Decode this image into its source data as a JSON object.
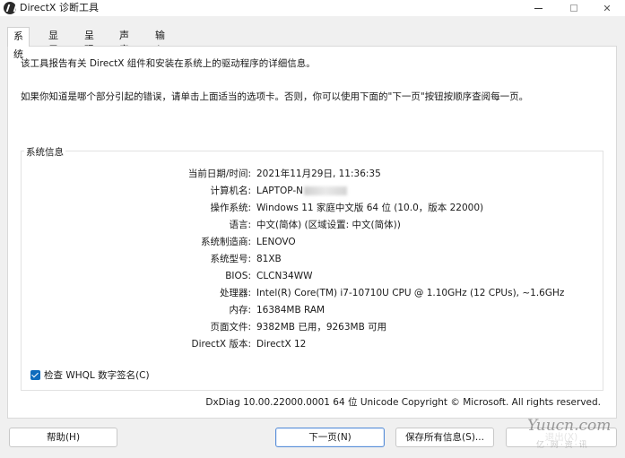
{
  "window": {
    "title": "DirectX 诊断工具",
    "icons": {
      "app": "directx-logo-icon",
      "minimize": "minimize-icon",
      "maximize": "maximize-icon",
      "close": "close-icon"
    },
    "close_glyph": "✕"
  },
  "tabs": [
    {
      "label": "系统",
      "active": true
    },
    {
      "label": "显示",
      "active": false
    },
    {
      "label": "呈现",
      "active": false
    },
    {
      "label": "声音",
      "active": false
    },
    {
      "label": "输入",
      "active": false
    }
  ],
  "intro": {
    "line1": "该工具报告有关 DirectX 组件和安装在系统上的驱动程序的详细信息。",
    "line2": "如果你知道是哪个部分引起的错误，请单击上面适当的选项卡。否则，你可以使用下面的\"下一页\"按钮按顺序查阅每一页。"
  },
  "system_info": {
    "group_label": "系统信息",
    "rows": [
      {
        "label": "当前日期/时间:",
        "value": "2021年11月29日, 11:36:35"
      },
      {
        "label": "计算机名:",
        "value": "LAPTOP-N"
      },
      {
        "label": "操作系统:",
        "value": "Windows 11 家庭中文版 64 位 (10.0，版本 22000)"
      },
      {
        "label": "语言:",
        "value": "中文(简体) (区域设置: 中文(简体))"
      },
      {
        "label": "系统制造商:",
        "value": "LENOVO"
      },
      {
        "label": "系统型号:",
        "value": "81XB"
      },
      {
        "label": "BIOS:",
        "value": "CLCN34WW"
      },
      {
        "label": "处理器:",
        "value": "Intel(R) Core(TM) i7-10710U CPU @ 1.10GHz (12 CPUs), ~1.6GHz"
      },
      {
        "label": "内存:",
        "value": "16384MB RAM"
      },
      {
        "label": "页面文件:",
        "value": "9382MB 已用，9263MB 可用"
      },
      {
        "label": "DirectX 版本:",
        "value": "DirectX 12"
      }
    ]
  },
  "whql": {
    "label": "检查 WHQL 数字签名(C)",
    "checked": true,
    "icon": "checkbox-checked-icon"
  },
  "copyright": "DxDiag 10.00.22000.0001 64 位 Unicode  Copyright © Microsoft. All rights reserved.",
  "buttons": {
    "help": "帮助(H)",
    "next": "下一页(N)",
    "save": "保存所有信息(S)...",
    "exit": "退出(X)"
  },
  "watermark": {
    "text": "Yuucn.com",
    "sub": "亿·网·资·讯"
  },
  "colors": {
    "accent": "#0f6cbd",
    "primary_border": "#5a8fd8",
    "panel": "#ffffff",
    "background": "#f0f0f0"
  }
}
